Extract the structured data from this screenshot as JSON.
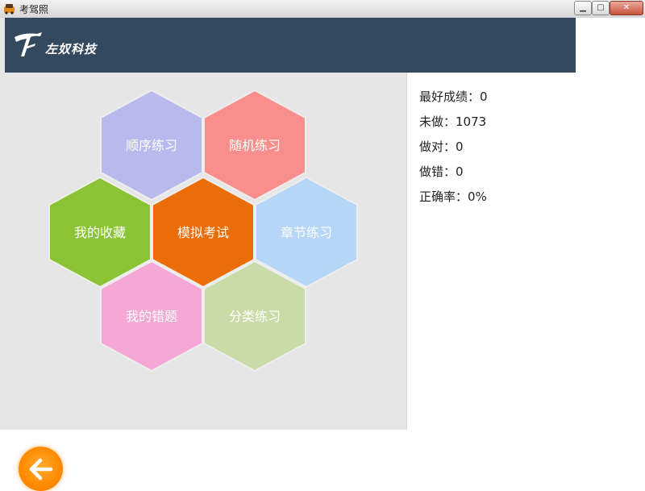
{
  "window": {
    "title": "考驾照",
    "min": "▁",
    "max": "▢",
    "close": "✕"
  },
  "header": {
    "brand": "左奴科技"
  },
  "menu": [
    {
      "id": "sequential",
      "label": "顺序练习",
      "color": "#b8b9ec"
    },
    {
      "id": "random",
      "label": "随机练习",
      "color": "#f98f8c"
    },
    {
      "id": "favorites",
      "label": "我的收藏",
      "color": "#8ac435"
    },
    {
      "id": "mock-exam",
      "label": "模拟考试",
      "color": "#eb6d08"
    },
    {
      "id": "chapter",
      "label": "章节练习",
      "color": "#b5d6f6"
    },
    {
      "id": "mistakes",
      "label": "我的错题",
      "color": "#f5a8d5"
    },
    {
      "id": "category",
      "label": "分类练习",
      "color": "#c9dca8"
    }
  ],
  "stats": {
    "best": "最好成绩：0",
    "undone": "未做：1073",
    "correct": "做对：0",
    "wrong": "做错：0",
    "accuracy": "正确率：0%"
  },
  "back": {
    "icon": "arrow-left-icon"
  }
}
